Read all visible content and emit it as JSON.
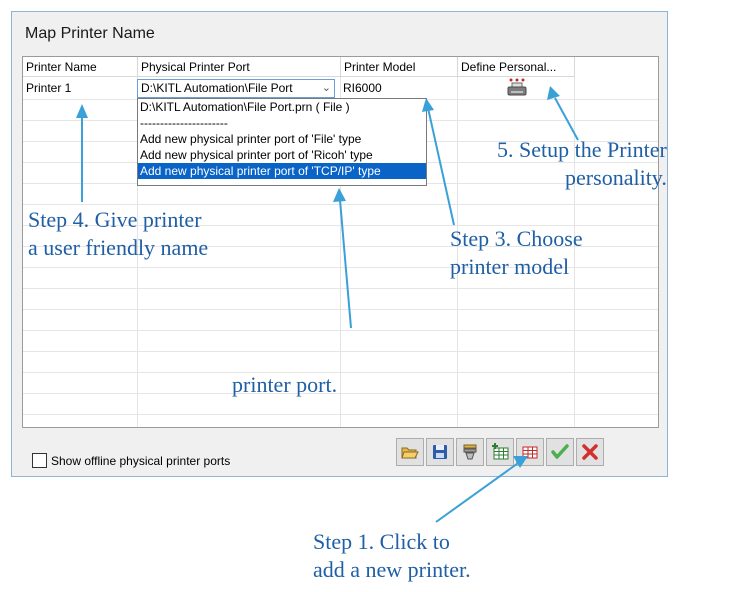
{
  "dialog": {
    "title": "Map Printer Name",
    "columns": [
      "Printer Name",
      "Physical Printer Port",
      "Printer Model",
      "Define Personal..."
    ],
    "row": {
      "printer_name": "Printer 1",
      "port_value": "D:\\KITL Automation\\File Port",
      "model": "RI6000",
      "personality_icon": "printer-icon"
    },
    "port_dropdown": {
      "options": [
        "D:\\KITL Automation\\File Port.prn ( File )",
        "----------------------",
        "Add new physical printer port of 'File' type",
        "Add new physical printer port of 'Ricoh' type",
        "Add new physical printer port of 'TCP/IP' type"
      ],
      "selected_index": 4
    },
    "show_offline_label": "Show offline physical printer ports",
    "show_offline_checked": false,
    "toolbar_icons": [
      "open-folder-icon",
      "save-icon",
      "filter-icon",
      "add-row-icon",
      "delete-row-icon",
      "check-icon",
      "close-icon"
    ]
  },
  "annotations": {
    "step4": [
      "Step 4. Give printer",
      "a user friendly name"
    ],
    "step3": [
      "Step 3. Choose",
      "printer model"
    ],
    "step5": [
      "5. Setup the Printer",
      "personality."
    ],
    "port": "printer port.",
    "step1": [
      "Step 1. Click to",
      "add a new printer."
    ]
  },
  "colors": {
    "annotation": "#1f5fa6",
    "arrow": "#3aa0d8",
    "selection": "#0a64c8",
    "dialog_border": "#8fb4d8"
  }
}
